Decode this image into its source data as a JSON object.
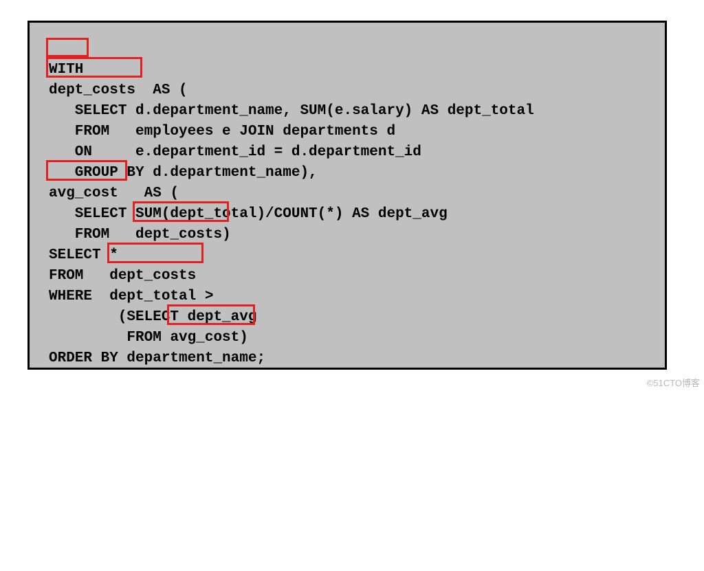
{
  "code": {
    "l1": "WITH",
    "l2a": "dept_costs",
    "l2b": "  AS (",
    "l3": "   SELECT d.department_name, SUM(e.salary) AS dept_total",
    "l4": "   FROM   employees e JOIN departments d",
    "l5": "   ON     e.department_id = d.department_id",
    "l6": "   GROUP BY d.department_name),",
    "l7a": "avg_cost",
    "l7b": "   AS (",
    "l8": "   SELECT SUM(dept_total)/COUNT(*) AS dept_avg",
    "l9a": "   FROM   ",
    "l9b": "dept_costs",
    "l9c": ")",
    "l10": "SELECT *",
    "l11a": "FROM   ",
    "l11b": "dept_costs",
    "l12": "WHERE  dept_total >",
    "l13": "        (SELECT dept_avg",
    "l14a": "         FROM ",
    "l14b": "avg_cost)",
    "l15": "ORDER BY department_name;"
  },
  "watermark": "©51CTO博客"
}
